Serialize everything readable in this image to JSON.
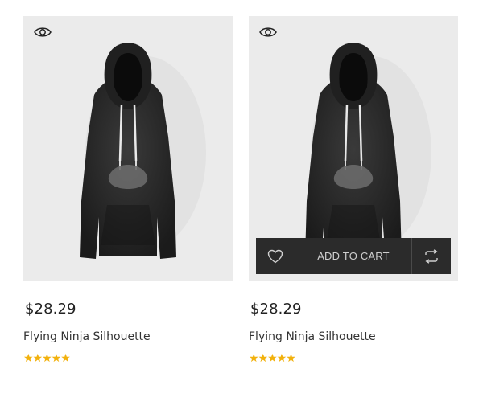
{
  "products": [
    {
      "price": "$28.29",
      "name": "Flying Ninja Silhouette",
      "rating_stars": "★★★★★",
      "rating_value": 5,
      "rating_max": 5,
      "quick_view_icon": "eye-icon",
      "image": "black hoodie"
    },
    {
      "price": "$28.29",
      "name": "Flying Ninja Silhouette",
      "rating_stars": "★★★★★",
      "rating_value": 5,
      "rating_max": 5,
      "quick_view_icon": "eye-icon",
      "image": "black hoodie",
      "actions": {
        "wishlist_icon": "heart-icon",
        "add_to_cart_label": "ADD TO CART",
        "compare_icon": "compare-arrows-icon"
      }
    }
  ],
  "colors": {
    "image_bg": "#ebebeb",
    "action_bar_bg": "#2b2b2b",
    "star": "#f2b10c",
    "price_text": "#222222"
  }
}
